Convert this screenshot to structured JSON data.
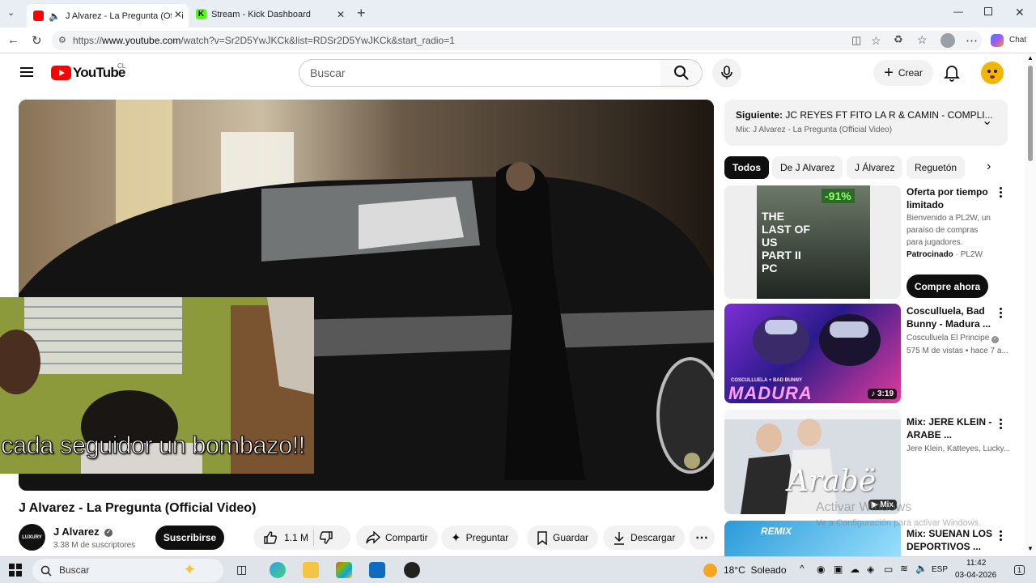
{
  "browser": {
    "tabs": [
      {
        "title": "J Alvarez - La Pregunta (Offici",
        "favicon_color": "#ff0000",
        "active": true
      },
      {
        "title": "Stream - Kick Dashboard",
        "favicon_color": "#53fc18",
        "active": false
      }
    ],
    "url_prefix": "https://",
    "url_domain": "www.youtube.com",
    "url_rest": "/watch?v=Sr2D5YwJKCk&list=RDSr2D5YwJKCk&start_radio=1",
    "chat_label": "Chat"
  },
  "header": {
    "logo_text": "YouTube",
    "country_code": "CL",
    "search_placeholder": "Buscar",
    "create_label": "Crear"
  },
  "player": {
    "overlay_text": "cada seguidor un bombazo!!"
  },
  "video": {
    "title": "J Alvarez - La Pregunta (Official Video)",
    "channel_name": "J Alvarez",
    "channel_avatar_text": "LUXURY",
    "subscribers": "3.38 M de suscriptores",
    "subscribe_label": "Suscribirse",
    "likes": "1.1 M",
    "share_label": "Compartir",
    "ask_label": "Preguntar",
    "save_label": "Guardar",
    "download_label": "Descargar"
  },
  "sidebar": {
    "next": {
      "label": "Siguiente:",
      "title": "JC REYES FT FITO LA R & CAMIN - COMPLI...",
      "subtitle": "Mix: J Alvarez - La Pregunta (Official Video)"
    },
    "chips": [
      "Todos",
      "De J Alvarez",
      "J Álvarez",
      "Reguetón"
    ],
    "ad": {
      "title": "Oferta por tiempo limitado",
      "description": "Bienvenido a PL2W, un paraíso de compras para jugadores.",
      "sponsored": "Patrocinado",
      "advertiser": "PL2W",
      "cta": "Compre ahora",
      "badge": "-91%",
      "game_text": "THE LAST OF US PART II PC"
    },
    "videos": [
      {
        "title": "Cosculluela, Bad Bunny - Madura ...",
        "channel": "Cosculluela El Principe",
        "meta": "575 M de vistas • hace 7 a...",
        "duration": "3:19",
        "thumb_caption_small": "COSCULLUELA + BAD BUNNY",
        "thumb_caption": "MADURA"
      },
      {
        "title": "Mix: JERE KLEIN - ARABE ...",
        "channel": "Jere Klein, Katteyes, Lucky...",
        "badge": "Mix",
        "thumb_caption": "Arabë"
      },
      {
        "title": "Mix: SUENAN LOS DEPORTIVOS ...",
        "thumb_caption": "REMIX"
      }
    ]
  },
  "watermark": {
    "line1": "Activar Windows",
    "line2": "Ve a Configuración para activar Windows."
  },
  "taskbar": {
    "search_placeholder": "Buscar",
    "weather": "18°C  Soleado",
    "language": "ESP",
    "time": "11:42",
    "date": "03-04-2026",
    "notifications": "1"
  }
}
